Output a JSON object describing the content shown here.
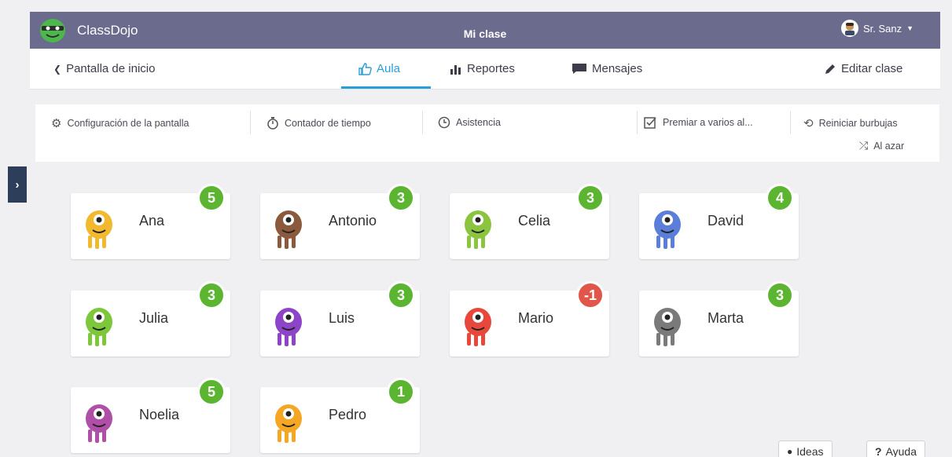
{
  "topbar": {
    "brand": "ClassDojo",
    "class_title": "Mi clase",
    "user_name": "Sr. Sanz"
  },
  "nav": {
    "home": "Pantalla de inicio",
    "tabs": [
      {
        "label": "Aula",
        "icon": "thumbs-up-icon",
        "active": true
      },
      {
        "label": "Reportes",
        "icon": "bar-chart-icon"
      },
      {
        "label": "Mensajes",
        "icon": "message-icon"
      }
    ],
    "edit": "Editar clase"
  },
  "toolbar": {
    "display_settings": "Configuración de la pantalla",
    "timer": "Contador de tiempo",
    "attendance": "Asistencia",
    "award_multiple": "Premiar a varios al...",
    "reset_bubbles": "Reiniciar burbujas",
    "random": "Al azar"
  },
  "students": [
    {
      "name": "Ana",
      "points": "5",
      "color": "#f2b82e",
      "type": "positive"
    },
    {
      "name": "Antonio",
      "points": "3",
      "color": "#8b5a3c",
      "type": "positive"
    },
    {
      "name": "Celia",
      "points": "3",
      "color": "#8bc53f",
      "type": "positive"
    },
    {
      "name": "David",
      "points": "4",
      "color": "#5b7fd9",
      "type": "positive"
    },
    {
      "name": "Julia",
      "points": "3",
      "color": "#7cc83a",
      "type": "positive"
    },
    {
      "name": "Luis",
      "points": "3",
      "color": "#8e44c8",
      "type": "positive"
    },
    {
      "name": "Mario",
      "points": "-1",
      "color": "#e8483b",
      "type": "negative"
    },
    {
      "name": "Marta",
      "points": "3",
      "color": "#7a7a7a",
      "type": "positive"
    },
    {
      "name": "Noelia",
      "points": "5",
      "color": "#b04fa8",
      "type": "positive"
    },
    {
      "name": "Pedro",
      "points": "1",
      "color": "#f5a623",
      "type": "positive"
    }
  ],
  "bottom": {
    "ideas": "Ideas",
    "help": "Ayuda"
  },
  "colors": {
    "positive": "#5cb531",
    "negative": "#e0564a",
    "accent": "#2a9fd6",
    "topbar": "#6b6b8e"
  }
}
